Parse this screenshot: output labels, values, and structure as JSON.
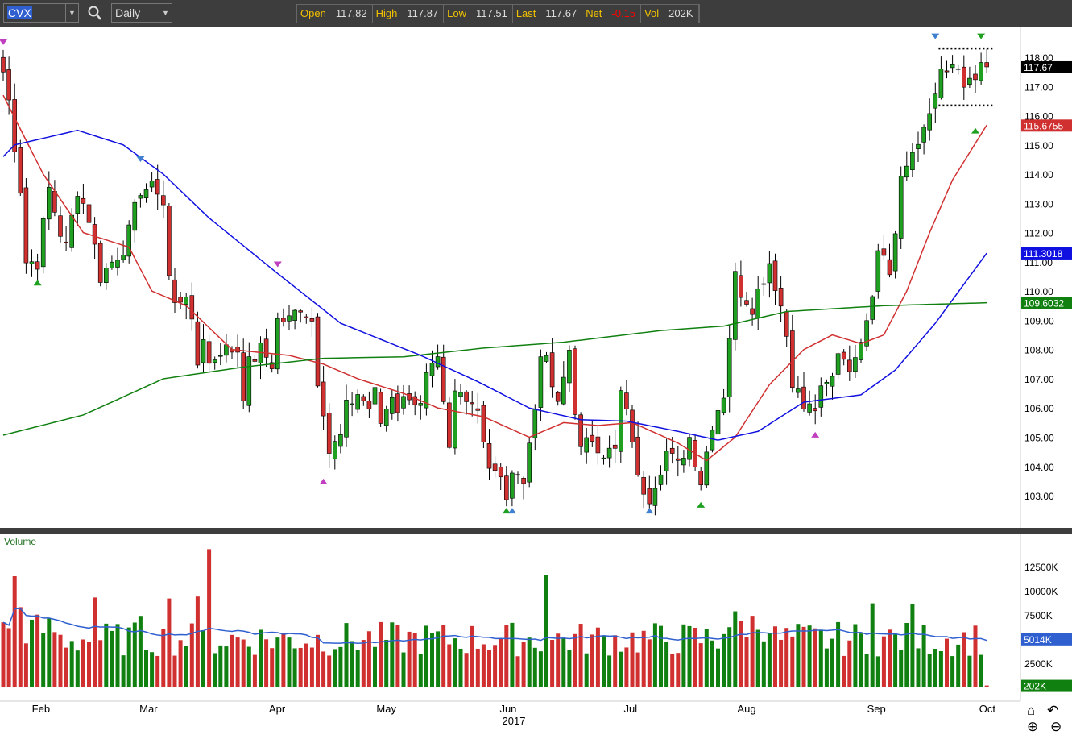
{
  "toolbar": {
    "symbol": "CVX",
    "period": "Daily",
    "quote": [
      {
        "label": "Open",
        "value": "117.82"
      },
      {
        "label": "High",
        "value": "117.87"
      },
      {
        "label": "Low",
        "value": "117.51"
      },
      {
        "label": "Last",
        "value": "117.67"
      },
      {
        "label": "Net",
        "value": "-0.15"
      },
      {
        "label": "Vol",
        "value": "202K"
      }
    ]
  },
  "volume_pane_label": "Volume",
  "chart_data": {
    "type": "candlestick",
    "ylim": [
      102.3,
      118.9
    ],
    "y_ticks": [
      "103.00",
      "104.00",
      "105.00",
      "106.00",
      "107.00",
      "108.00",
      "109.00",
      "110.00",
      "111.00",
      "112.00",
      "113.00",
      "114.00",
      "115.00",
      "116.00",
      "117.00",
      "118.00"
    ],
    "x_ticks": [
      {
        "label": "Feb",
        "bar": 6.6
      },
      {
        "label": "Mar",
        "bar": 25.4
      },
      {
        "label": "Apr",
        "bar": 47.9
      },
      {
        "label": "May",
        "bar": 67
      },
      {
        "label": "Jun",
        "bar": 88.3
      },
      {
        "label": "Jul",
        "bar": 109.7
      },
      {
        "label": "Aug",
        "bar": 130
      },
      {
        "label": "Sep",
        "bar": 152.7
      },
      {
        "label": "Oct",
        "bar": 172.1
      }
    ],
    "year_label": "2017",
    "bars": 173,
    "close_path": [
      [
        0,
        117.5
      ],
      [
        1,
        116.5
      ],
      [
        3,
        113.5
      ],
      [
        4,
        111
      ],
      [
        6,
        111
      ],
      [
        8,
        113.5
      ],
      [
        10,
        112
      ],
      [
        11,
        111.5
      ],
      [
        13,
        113.5
      ],
      [
        15,
        112.5
      ],
      [
        17,
        110.5
      ],
      [
        19,
        111
      ],
      [
        21,
        111.5
      ],
      [
        22,
        112
      ],
      [
        24,
        113.5
      ],
      [
        27,
        113.5
      ],
      [
        28,
        113
      ],
      [
        29,
        110.5
      ],
      [
        30,
        109.5
      ],
      [
        32,
        110
      ],
      [
        34,
        107.5
      ],
      [
        35,
        108.5
      ],
      [
        36,
        107.5
      ],
      [
        38,
        108
      ],
      [
        41,
        108
      ],
      [
        42,
        106.5
      ],
      [
        43,
        107.5
      ],
      [
        45,
        108
      ],
      [
        47,
        107.5
      ],
      [
        48,
        109
      ],
      [
        50,
        109
      ],
      [
        52,
        109.5
      ],
      [
        54,
        109
      ],
      [
        55,
        107
      ],
      [
        56,
        106
      ],
      [
        57,
        104.5
      ],
      [
        59,
        105
      ],
      [
        60,
        106
      ],
      [
        62,
        106.5
      ],
      [
        64,
        106
      ],
      [
        65,
        106.5
      ],
      [
        66,
        105.5
      ],
      [
        68,
        106.5
      ],
      [
        69,
        106
      ],
      [
        71,
        106.5
      ],
      [
        73,
        106
      ],
      [
        74,
        107
      ],
      [
        76,
        107.5
      ],
      [
        78,
        104.5
      ],
      [
        79,
        106.5
      ],
      [
        81,
        106.5
      ],
      [
        83,
        106
      ],
      [
        84,
        105
      ],
      [
        85,
        104
      ],
      [
        87,
        103.5
      ],
      [
        88,
        103
      ],
      [
        90,
        104
      ],
      [
        91,
        103.5
      ],
      [
        93,
        106
      ],
      [
        94,
        108
      ],
      [
        95,
        107.5
      ],
      [
        97,
        106
      ],
      [
        99,
        108
      ],
      [
        100,
        106
      ],
      [
        101,
        104.5
      ],
      [
        103,
        105
      ],
      [
        105,
        104.5
      ],
      [
        107,
        104.5
      ],
      [
        108,
        106.5
      ],
      [
        110,
        105
      ],
      [
        111,
        103.5
      ],
      [
        113,
        103
      ],
      [
        114,
        103.5
      ],
      [
        116,
        104.5
      ],
      [
        118,
        104
      ],
      [
        120,
        105
      ],
      [
        122,
        103.5
      ],
      [
        123,
        104.5
      ],
      [
        124,
        105.5
      ],
      [
        126,
        106.5
      ],
      [
        127,
        108.5
      ],
      [
        128,
        110.5
      ],
      [
        129,
        110
      ],
      [
        131,
        109.5
      ],
      [
        133,
        110.5
      ],
      [
        134,
        111
      ],
      [
        136,
        109.5
      ],
      [
        137,
        108.5
      ],
      [
        138,
        107
      ],
      [
        140,
        106
      ],
      [
        142,
        106
      ],
      [
        143,
        106.5
      ],
      [
        145,
        107
      ],
      [
        146,
        108
      ],
      [
        148,
        107.5
      ],
      [
        149,
        107.5
      ],
      [
        150,
        108.5
      ],
      [
        152,
        110
      ],
      [
        153,
        111.5
      ],
      [
        154,
        111.5
      ],
      [
        155,
        110.5
      ],
      [
        156,
        112
      ],
      [
        157,
        114
      ],
      [
        159,
        114.5
      ],
      [
        160,
        115
      ],
      [
        162,
        116.3
      ],
      [
        163,
        116.5
      ],
      [
        164,
        117.5
      ],
      [
        166,
        117.5
      ],
      [
        167,
        117.5
      ],
      [
        168,
        117
      ],
      [
        170,
        117
      ],
      [
        171,
        117.82
      ],
      [
        172,
        117.67
      ]
    ],
    "ma_series": [
      {
        "name": "MA20",
        "color": "#d03030",
        "last": "115.6755",
        "points": [
          [
            0,
            116.7
          ],
          [
            7,
            114
          ],
          [
            14,
            112
          ],
          [
            22,
            111.5
          ],
          [
            26,
            110
          ],
          [
            32,
            109.5
          ],
          [
            40,
            108
          ],
          [
            50,
            107.8
          ],
          [
            56,
            107.5
          ],
          [
            62,
            107
          ],
          [
            70,
            106.5
          ],
          [
            76,
            106
          ],
          [
            84,
            105.7
          ],
          [
            92,
            105
          ],
          [
            98,
            105.5
          ],
          [
            104,
            105.4
          ],
          [
            110,
            105.5
          ],
          [
            118,
            104.8
          ],
          [
            123,
            104.2
          ],
          [
            128,
            105
          ],
          [
            134,
            106.8
          ],
          [
            140,
            108
          ],
          [
            145,
            108.5
          ],
          [
            150,
            108.2
          ],
          [
            154,
            108.5
          ],
          [
            158,
            110
          ],
          [
            162,
            112
          ],
          [
            166,
            113.8
          ],
          [
            172,
            115.68
          ]
        ]
      },
      {
        "name": "MA50",
        "color": "#1010e0",
        "last": "111.3018",
        "points": [
          [
            0,
            114.6
          ],
          [
            2,
            115
          ],
          [
            13,
            115.5
          ],
          [
            21,
            115
          ],
          [
            28,
            114
          ],
          [
            36,
            112.5
          ],
          [
            48,
            110.6
          ],
          [
            59,
            108.9
          ],
          [
            73,
            107.8
          ],
          [
            83,
            106.9
          ],
          [
            92,
            106
          ],
          [
            101,
            105.6
          ],
          [
            109,
            105.55
          ],
          [
            118,
            105.2
          ],
          [
            125,
            104.9
          ],
          [
            132,
            105.2
          ],
          [
            140,
            106.2
          ],
          [
            150,
            106.45
          ],
          [
            156,
            107.3
          ],
          [
            163,
            108.9
          ],
          [
            172,
            111.3
          ]
        ]
      },
      {
        "name": "MA200",
        "color": "#108010",
        "last": "109.6032",
        "points": [
          [
            0,
            105.07
          ],
          [
            14,
            105.76
          ],
          [
            28,
            107
          ],
          [
            42,
            107.4
          ],
          [
            56,
            107.7
          ],
          [
            70,
            107.75
          ],
          [
            84,
            108.05
          ],
          [
            98,
            108.25
          ],
          [
            115,
            108.65
          ],
          [
            126,
            108.8
          ],
          [
            137,
            109.3
          ],
          [
            154,
            109.5
          ],
          [
            172,
            109.6
          ]
        ]
      }
    ],
    "last_price": "117.67",
    "volume": {
      "y_ticks": [
        "2500K",
        "5000K",
        "7500K",
        "10000K",
        "12500K"
      ],
      "ylim": [
        0,
        14500
      ],
      "avg_label": "5014K",
      "last_label": "202K",
      "last": 202,
      "avg": 5014,
      "spikes": [
        [
          2,
          11500
        ],
        [
          3,
          8300
        ],
        [
          16,
          9300
        ],
        [
          24,
          7400
        ],
        [
          29,
          9200
        ],
        [
          34,
          9400
        ],
        [
          36,
          14300
        ],
        [
          95,
          11600
        ],
        [
          152,
          8700
        ],
        [
          159,
          8600
        ]
      ]
    }
  }
}
